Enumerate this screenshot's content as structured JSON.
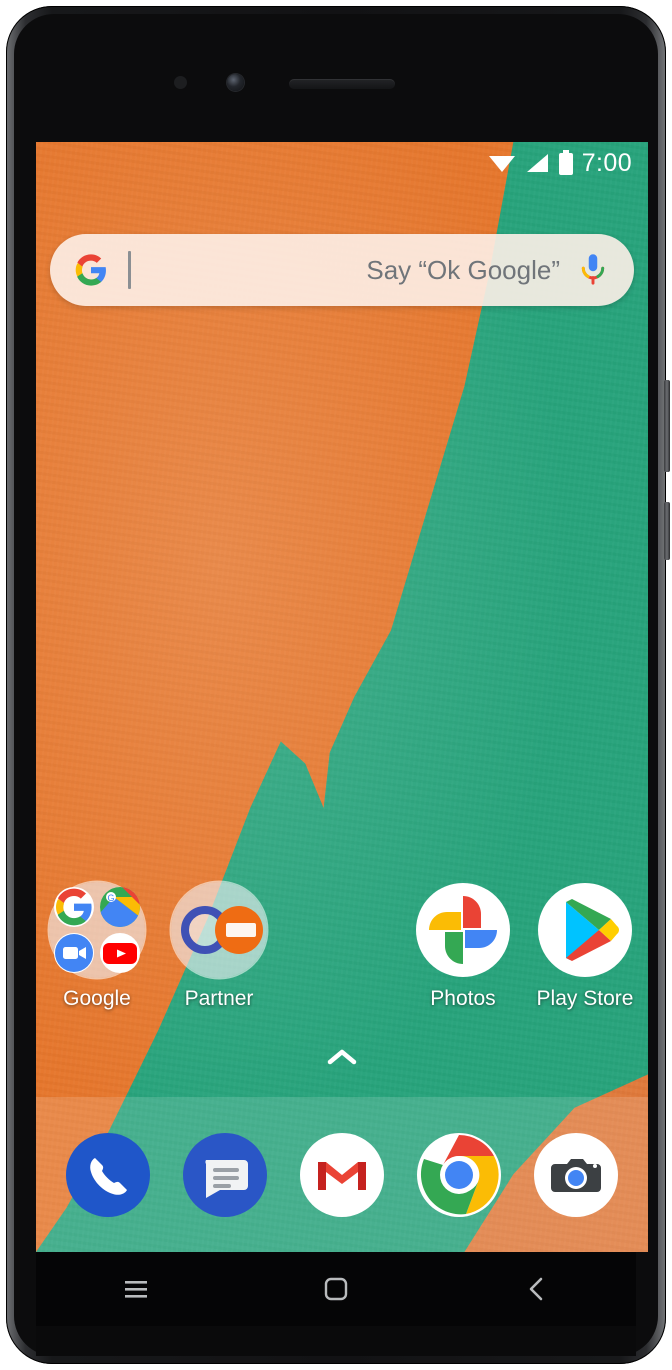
{
  "device": {
    "name": "android-smartphone",
    "hardware": {
      "sensor": "proximity-sensor",
      "camera": "front-camera",
      "earpiece": "earpiece-speaker",
      "volume_button": "volume-rocker",
      "power_button": "power-button"
    }
  },
  "statusbar": {
    "time": "7:00",
    "icons": [
      "wifi-icon",
      "cellular-signal-icon",
      "battery-icon"
    ],
    "text_color": "#ffffff"
  },
  "search": {
    "logo": "google-g-logo",
    "value": "",
    "placeholder": "Say “Ok Google”",
    "mic": "microphone-icon",
    "background": "#fdf0e8",
    "hint_color": "#70757a"
  },
  "wallpaper": {
    "orange": "#e6762c",
    "teal": "#27a37b"
  },
  "homescreen": {
    "apps": [
      {
        "label": "Google",
        "icon": "google-folder",
        "type": "folder",
        "contents": [
          "google-search-icon",
          "google-maps-icon",
          "google-duo-icon",
          "youtube-icon"
        ]
      },
      {
        "label": "Partner",
        "icon": "partner-folder",
        "type": "folder",
        "contents": [
          "blue-ring-icon",
          "orange-g-icon"
        ]
      },
      {
        "label": "Photos",
        "icon": "google-photos-icon",
        "type": "app"
      },
      {
        "label": "Play Store",
        "icon": "google-play-icon",
        "type": "app"
      }
    ],
    "drawer_indicator": "chevron-up-icon"
  },
  "dock": {
    "apps": [
      {
        "label": "Phone",
        "icon": "phone-icon",
        "color": "#1f56c9"
      },
      {
        "label": "Messages",
        "icon": "messages-icon",
        "color": "#2a56c6"
      },
      {
        "label": "Gmail",
        "icon": "gmail-icon",
        "color": "#ea4335"
      },
      {
        "label": "Chrome",
        "icon": "chrome-icon",
        "color": "#4285f4"
      },
      {
        "label": "Camera",
        "icon": "camera-icon",
        "color": "#3c4043"
      }
    ]
  },
  "navbar": {
    "buttons": [
      {
        "label": "Recents",
        "icon": "recents-menu-icon"
      },
      {
        "label": "Home",
        "icon": "home-square-icon"
      },
      {
        "label": "Back",
        "icon": "back-chevron-icon"
      }
    ]
  }
}
